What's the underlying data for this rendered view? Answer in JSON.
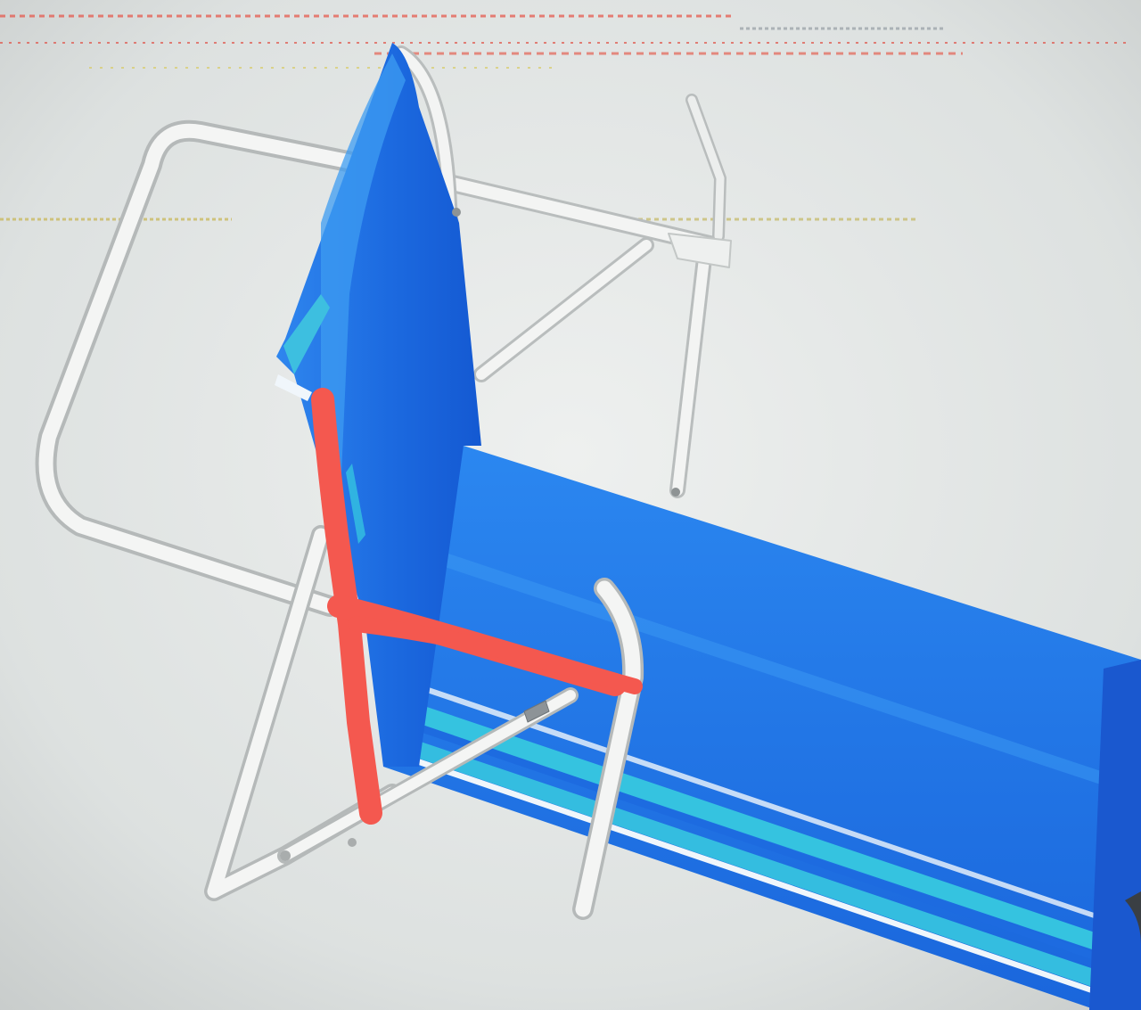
{
  "photo": {
    "subject": "folding-beach-lounger",
    "annotation_color": "#f4584f"
  },
  "colors": {
    "background": "#dfe3e2",
    "frame": "#f3f4f3",
    "frame_shadow": "#b9bdbd",
    "fabric_dark": "#1660d8",
    "fabric_mid": "#2a84ee",
    "fabric_light": "#43a6f2",
    "stripe_cyan": "#35c3e0",
    "stripe_white": "#f0f6fb",
    "annotation": "#f4584f"
  }
}
